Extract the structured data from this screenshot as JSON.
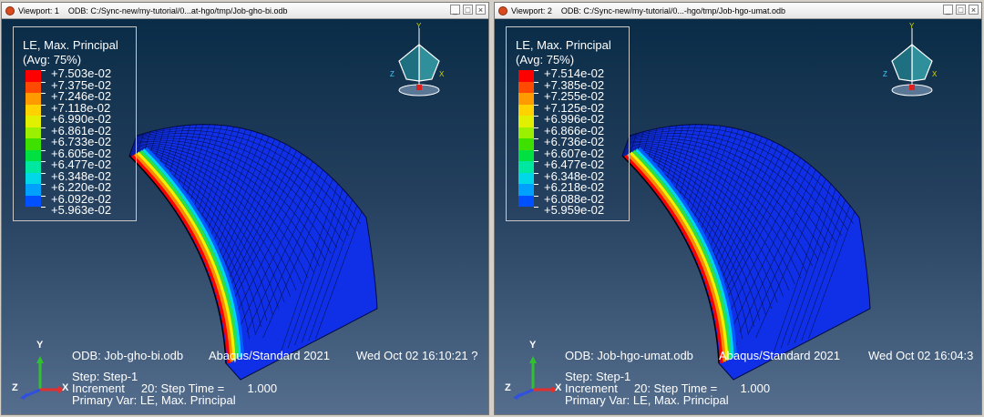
{
  "viewports": [
    {
      "title": "Viewport: 1",
      "odb_path": "ODB: C:/Sync-new/my-tutorial/0...at-hgo/tmp/Job-gho-bi.odb",
      "legend": {
        "title": "LE, Max. Principal",
        "subtitle": "(Avg: 75%)",
        "values": [
          "+7.503e-02",
          "+7.375e-02",
          "+7.246e-02",
          "+7.118e-02",
          "+6.990e-02",
          "+6.861e-02",
          "+6.733e-02",
          "+6.605e-02",
          "+6.477e-02",
          "+6.348e-02",
          "+6.220e-02",
          "+6.092e-02",
          "+5.963e-02"
        ]
      },
      "info": {
        "odb": "ODB: Job-gho-bi.odb",
        "solver": "Abaqus/Standard 2021",
        "date": "Wed Oct 02 16:10:21 ?",
        "step": "Step: Step-1",
        "increment": "Increment     20: Step Time =       1.000",
        "primary_var": "Primary Var: LE, Max. Principal"
      }
    },
    {
      "title": "Viewport: 2",
      "odb_path": "ODB: C:/Sync-new/my-tutorial/0...-hgo/tmp/Job-hgo-umat.odb",
      "legend": {
        "title": "LE, Max. Principal",
        "subtitle": "(Avg: 75%)",
        "values": [
          "+7.514e-02",
          "+7.385e-02",
          "+7.255e-02",
          "+7.125e-02",
          "+6.996e-02",
          "+6.866e-02",
          "+6.736e-02",
          "+6.607e-02",
          "+6.477e-02",
          "+6.348e-02",
          "+6.218e-02",
          "+6.088e-02",
          "+5.959e-02"
        ]
      },
      "info": {
        "odb": "ODB: Job-hgo-umat.odb",
        "solver": "Abaqus/Standard 2021",
        "date": "Wed Oct 02 16:04:3",
        "step": "Step: Step-1",
        "increment": "Increment     20: Step Time =       1.000",
        "primary_var": "Primary Var: LE, Max. Principal"
      }
    }
  ],
  "legend_colors": [
    "#ff0000",
    "#ff4a00",
    "#ff9a00",
    "#ffd200",
    "#e0f000",
    "#9af000",
    "#3ee000",
    "#00e040",
    "#00e8a0",
    "#00d8e8",
    "#00a0ff",
    "#0050ff",
    "#0000ff"
  ],
  "triad": {
    "x": "X",
    "y": "Y",
    "z": "Z"
  },
  "view_cube": {
    "x": "X",
    "y": "Y",
    "z": "Z"
  },
  "window_buttons": [
    "_",
    "□",
    "×"
  ]
}
